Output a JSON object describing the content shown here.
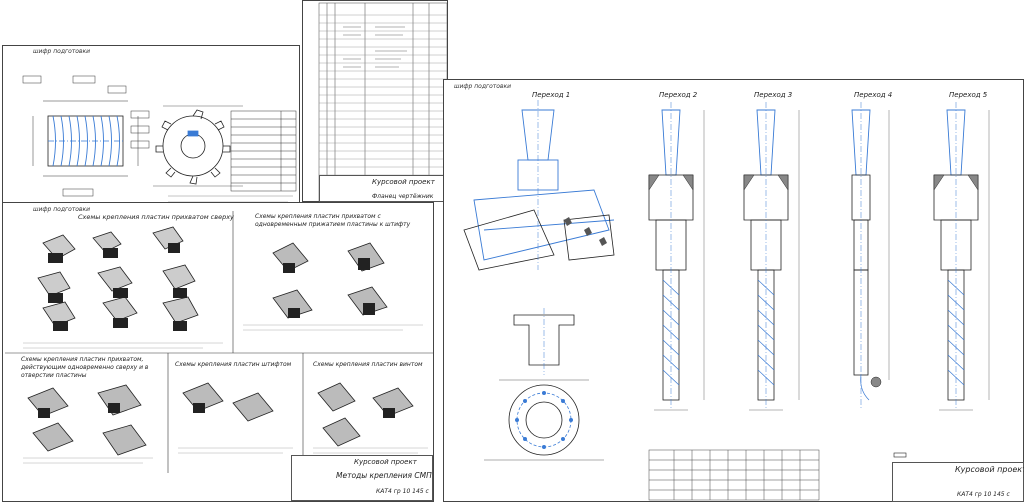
{
  "sheets": {
    "cutter": {
      "corner_stamp": "шифр подготовки"
    },
    "schemes": {
      "corner_stamp": "шифр подготовки",
      "title_1": "Схемы крепления пластин прихватом сверху",
      "title_2": "Схемы крепления пластин прихватом с одновременным прижатием пластины к штифту",
      "title_3": "Схемы крепления пластин прихватом, действующим одновременно сверху и в отверстии пластины",
      "title_4": "Схемы крепления пластин штифтом",
      "title_5": "Схемы крепления пластин винтом",
      "title_block": {
        "project": "Курсовой проект",
        "title": "Методы крепления СМП",
        "code": "КАТ4 гр 10 145 с"
      }
    },
    "spec": {
      "title_block": {
        "project": "Курсовой проект",
        "title": "Фланец чертёжник"
      }
    },
    "tooling": {
      "corner_stamp": "шифр подготовки",
      "transitions": [
        "Переход 1",
        "Переход 2",
        "Переход 3",
        "Переход 4",
        "Переход 5"
      ],
      "title_block": {
        "project": "Курсовой проект",
        "code": "КАТ4 гр 10 145 с"
      }
    }
  }
}
